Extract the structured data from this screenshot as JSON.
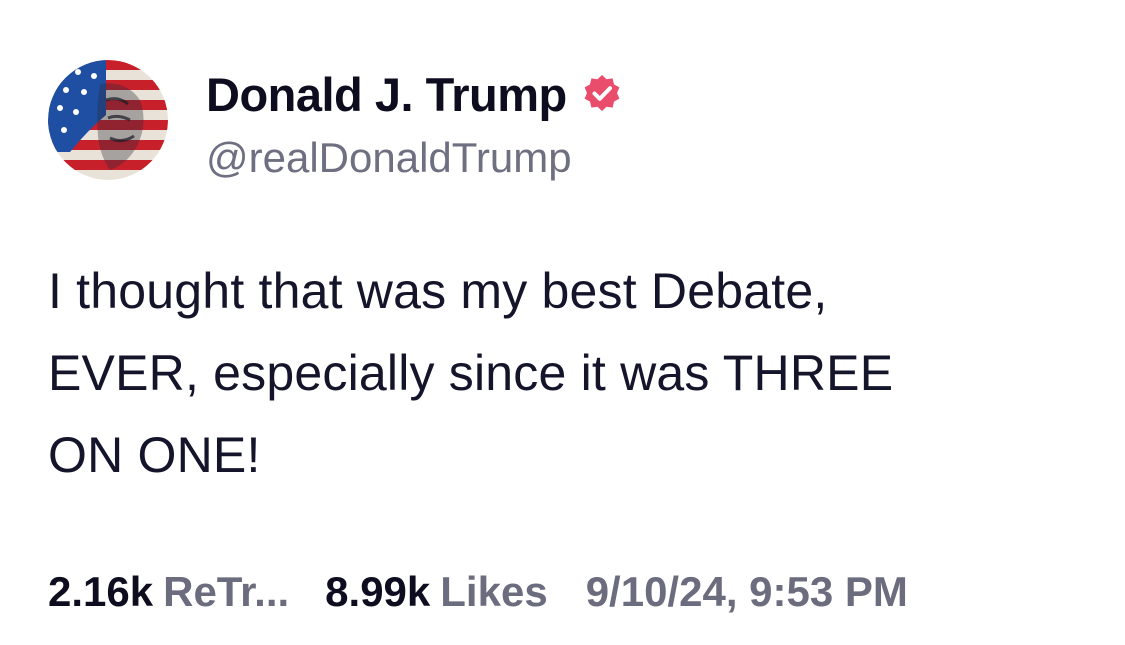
{
  "author": {
    "display_name": "Donald J. Trump",
    "handle": "@realDonaldTrump",
    "avatar_icon": "flag-portrait-avatar",
    "verified_icon": "verified-badge-icon",
    "verified_color": "#ea4c6c"
  },
  "post": {
    "lines": [
      "I thought that was my best Debate,",
      "EVER, especially since it was THREE",
      "ON ONE!"
    ]
  },
  "stats": {
    "retruths_count": "2.16k",
    "retruths_label": "ReTr...",
    "likes_count": "8.99k",
    "likes_label": "Likes",
    "timestamp": "9/10/24, 9:53 PM"
  }
}
